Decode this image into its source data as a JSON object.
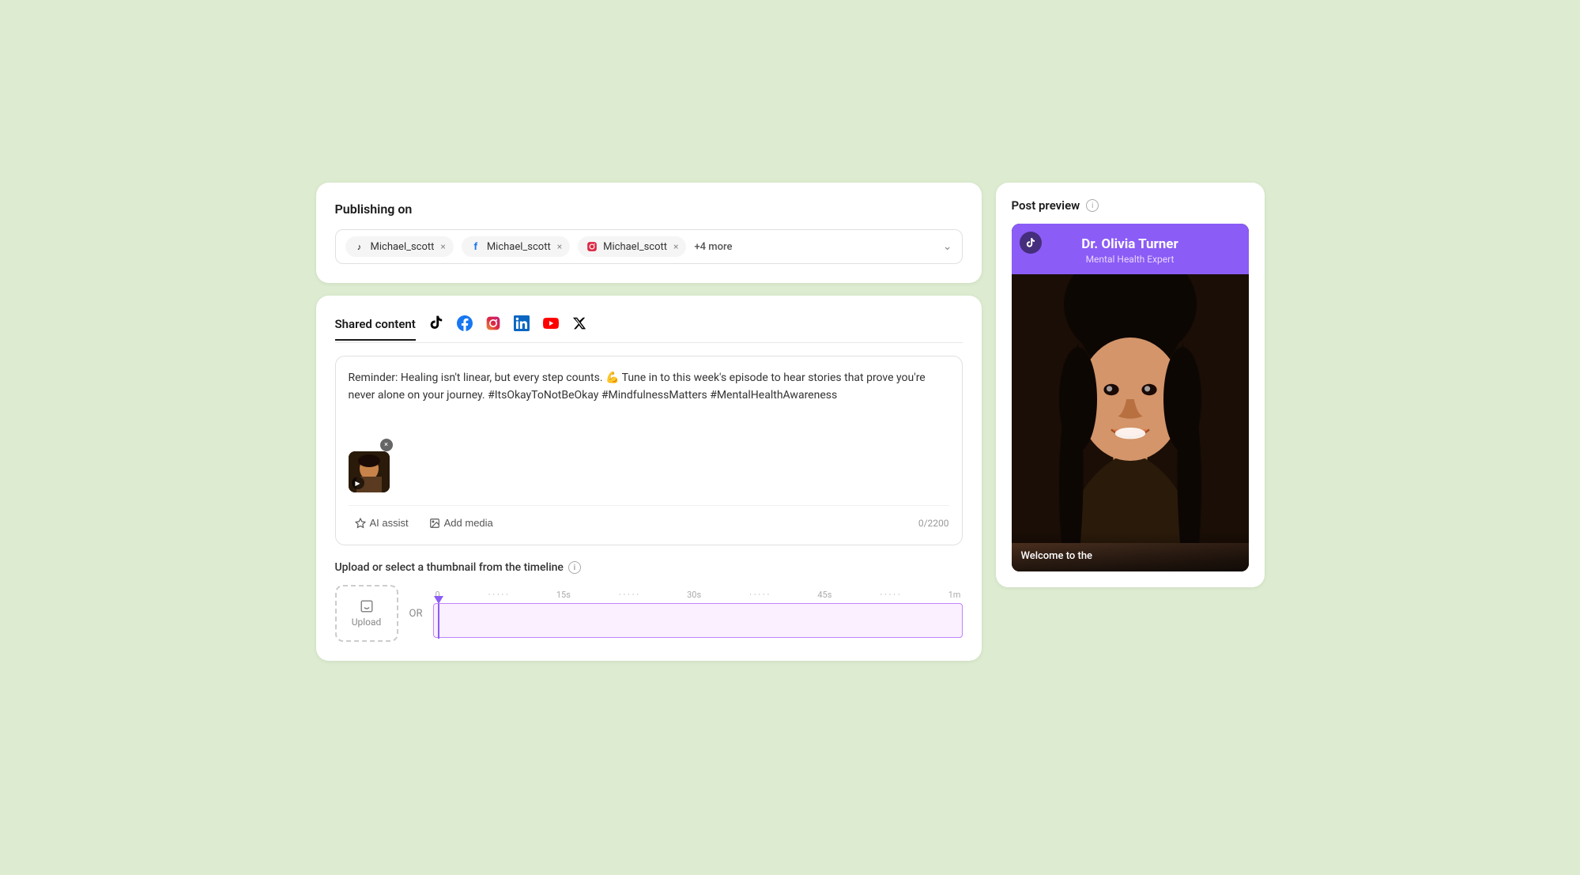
{
  "publishing": {
    "title": "Publishing on",
    "accounts": [
      {
        "platform": "tiktok",
        "name": "Michael_scott",
        "icon": "♪"
      },
      {
        "platform": "facebook",
        "name": "Michael_scott",
        "icon": "f"
      },
      {
        "platform": "instagram",
        "name": "Michael_scott",
        "icon": "📷"
      }
    ],
    "more_label": "+4 more"
  },
  "shared_content": {
    "tab_label": "Shared content",
    "tabs": [
      "tiktok",
      "facebook",
      "instagram",
      "linkedin",
      "youtube",
      "x"
    ],
    "content_text": "Reminder: Healing isn't linear, but every step counts. 💪 Tune in to this week's episode to hear stories that prove you're never alone on your journey. #ItsOkayToNotBeOkay #MindfulnessMatters #MentalHealthAwareness",
    "char_count": "0/2200",
    "ai_assist_label": "AI assist",
    "add_media_label": "Add media",
    "thumbnail_label": "Upload or select a thumbnail from the timeline",
    "upload_label": "Upload",
    "or_label": "OR",
    "timeline_marks": [
      "0",
      "15s",
      "30s",
      "45s",
      "1m"
    ]
  },
  "post_preview": {
    "title": "Post preview",
    "person_name": "Dr. Olivia Turner",
    "person_subtitle": "Mental Health Expert",
    "caption": "Welcome to the"
  }
}
